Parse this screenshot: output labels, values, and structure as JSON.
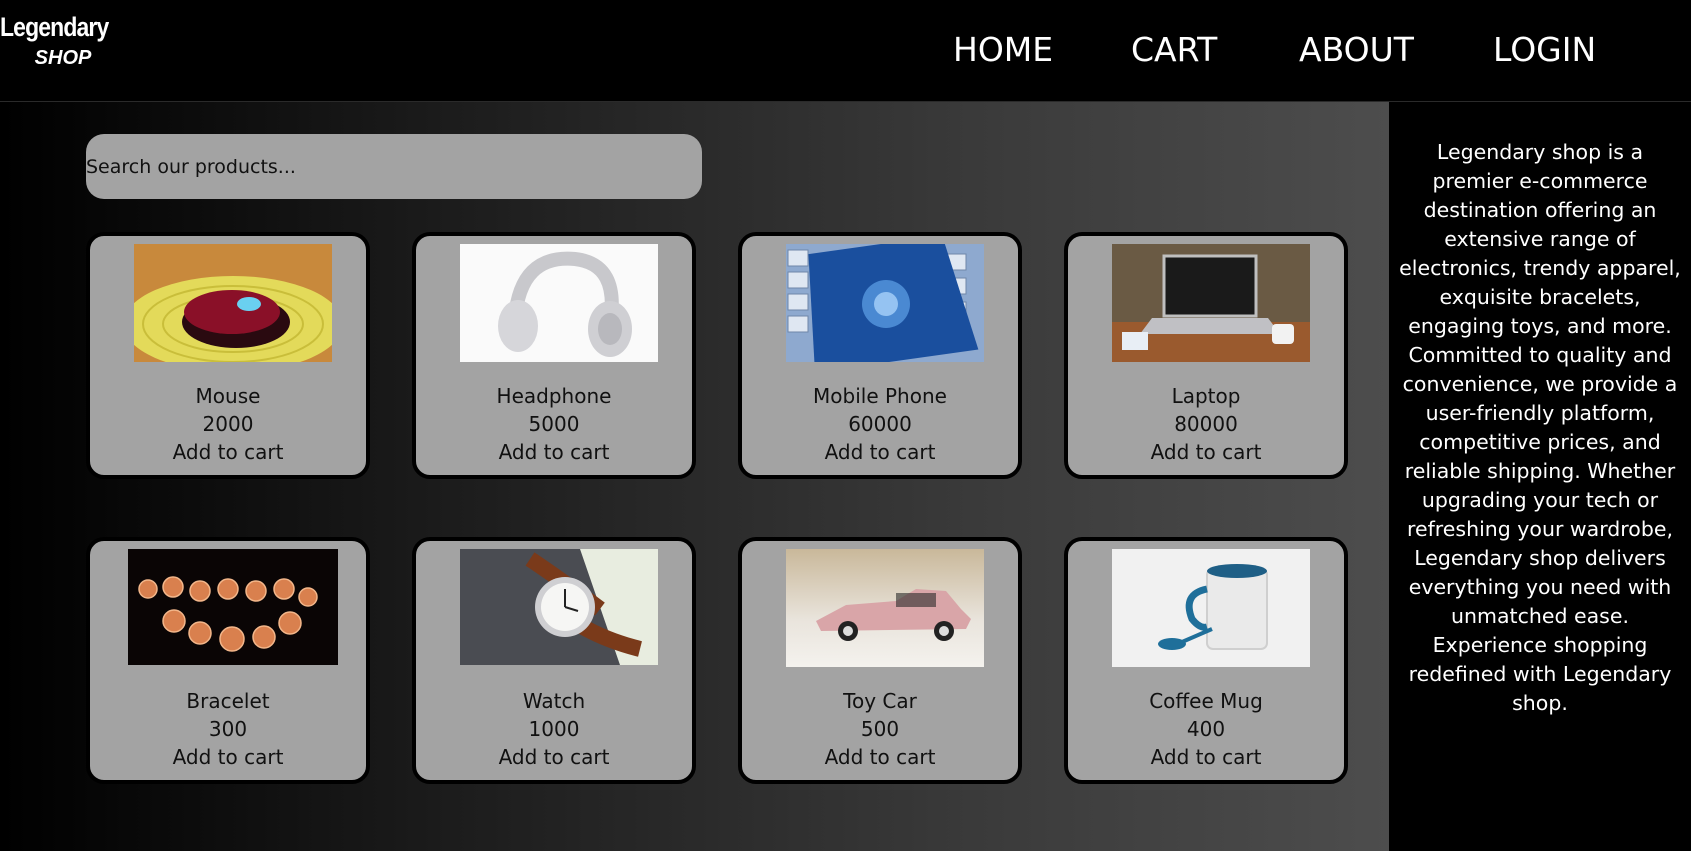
{
  "header": {
    "logo_line1": "Legendary",
    "logo_line2": "SHOP",
    "nav": [
      "HOME",
      "CART",
      "ABOUT",
      "LOGIN"
    ]
  },
  "search": {
    "placeholder": "Search our products..."
  },
  "products": [
    {
      "name": "Mouse",
      "price": "2000",
      "action": "Add to cart",
      "image": "computer-mouse-photo"
    },
    {
      "name": "Headphone",
      "price": "5000",
      "action": "Add to cart",
      "image": "headphones-photo"
    },
    {
      "name": "Mobile Phone",
      "price": "60000",
      "action": "Add to cart",
      "image": "smartphone-photo"
    },
    {
      "name": "Laptop",
      "price": "80000",
      "action": "Add to cart",
      "image": "laptop-photo"
    },
    {
      "name": "Bracelet",
      "price": "300",
      "action": "Add to cart",
      "image": "bead-bracelet-photo"
    },
    {
      "name": "Watch",
      "price": "1000",
      "action": "Add to cart",
      "image": "wristwatch-photo"
    },
    {
      "name": "Toy Car",
      "price": "500",
      "action": "Add to cart",
      "image": "toy-car-photo"
    },
    {
      "name": "Coffee Mug",
      "price": "400",
      "action": "Add to cart",
      "image": "coffee-mug-photo"
    }
  ],
  "sidebar": {
    "about": "Legendary shop is a premier e-commerce destination offering an extensive range of electronics, trendy apparel, exquisite bracelets, engaging toys, and more. Committed to quality and convenience, we provide a user-friendly platform, competitive prices, and reliable shipping. Whether upgrading your tech or refreshing your wardrobe, Legendary shop delivers everything you need with unmatched ease. Experience shopping redefined with Legendary shop."
  },
  "colors": {
    "background": "#000000",
    "card": "#a3a3a3",
    "search": "#a3a3a3",
    "text_light": "#ffffff"
  }
}
